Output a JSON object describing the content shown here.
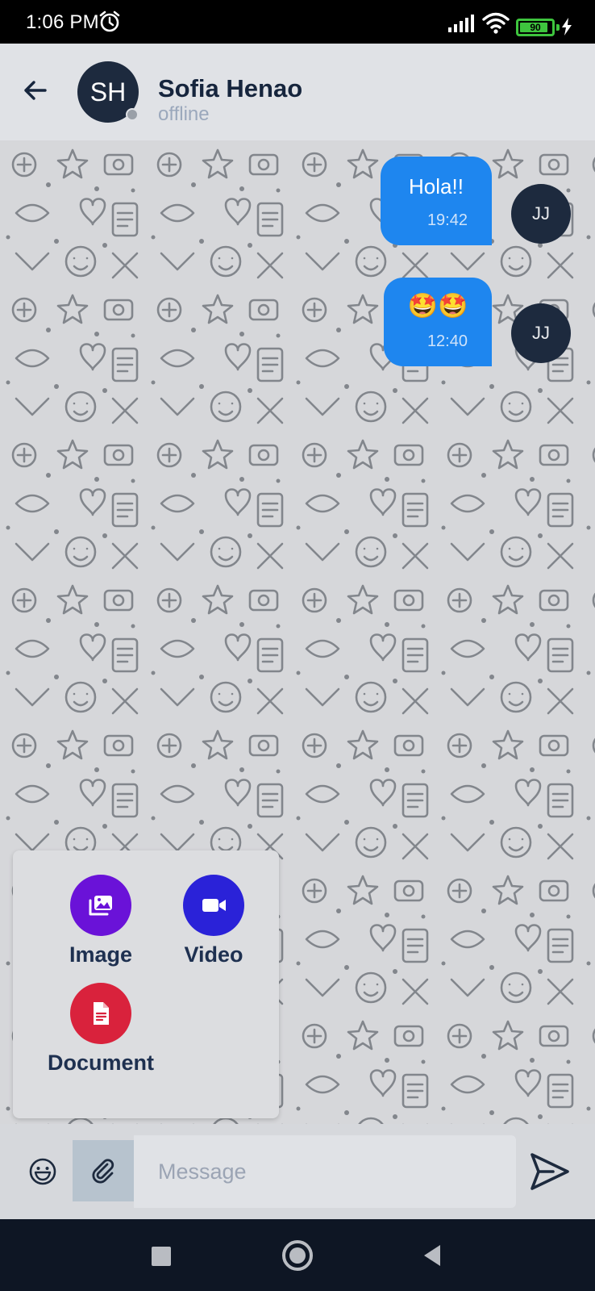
{
  "status_bar": {
    "time": "1:06 PM",
    "battery_level": "90",
    "battery_fraction": 0.9,
    "icons": [
      "alarm-icon",
      "signal-icon",
      "wifi-icon",
      "battery-icon",
      "charging-icon"
    ]
  },
  "header": {
    "avatar_initials": "SH",
    "name": "Sofia Henao",
    "status": "offline"
  },
  "messages": [
    {
      "text": "Hola!!",
      "time": "19:42",
      "avatar": "JJ"
    },
    {
      "text": "🤩🤩",
      "time": "12:40",
      "avatar": "JJ"
    }
  ],
  "attach_menu": {
    "options": [
      {
        "label": "Image",
        "icon": "image-icon",
        "color": "#6a12d8"
      },
      {
        "label": "Video",
        "icon": "video-icon",
        "color": "#2a22d8"
      },
      {
        "label": "Document",
        "icon": "document-icon",
        "color": "#d9223c"
      }
    ]
  },
  "input": {
    "placeholder": "Message"
  },
  "colors": {
    "bubble": "#1e86ef",
    "header_bg": "#e0e2e6",
    "nav_bg": "#0e1624",
    "name_text": "#16253d"
  }
}
